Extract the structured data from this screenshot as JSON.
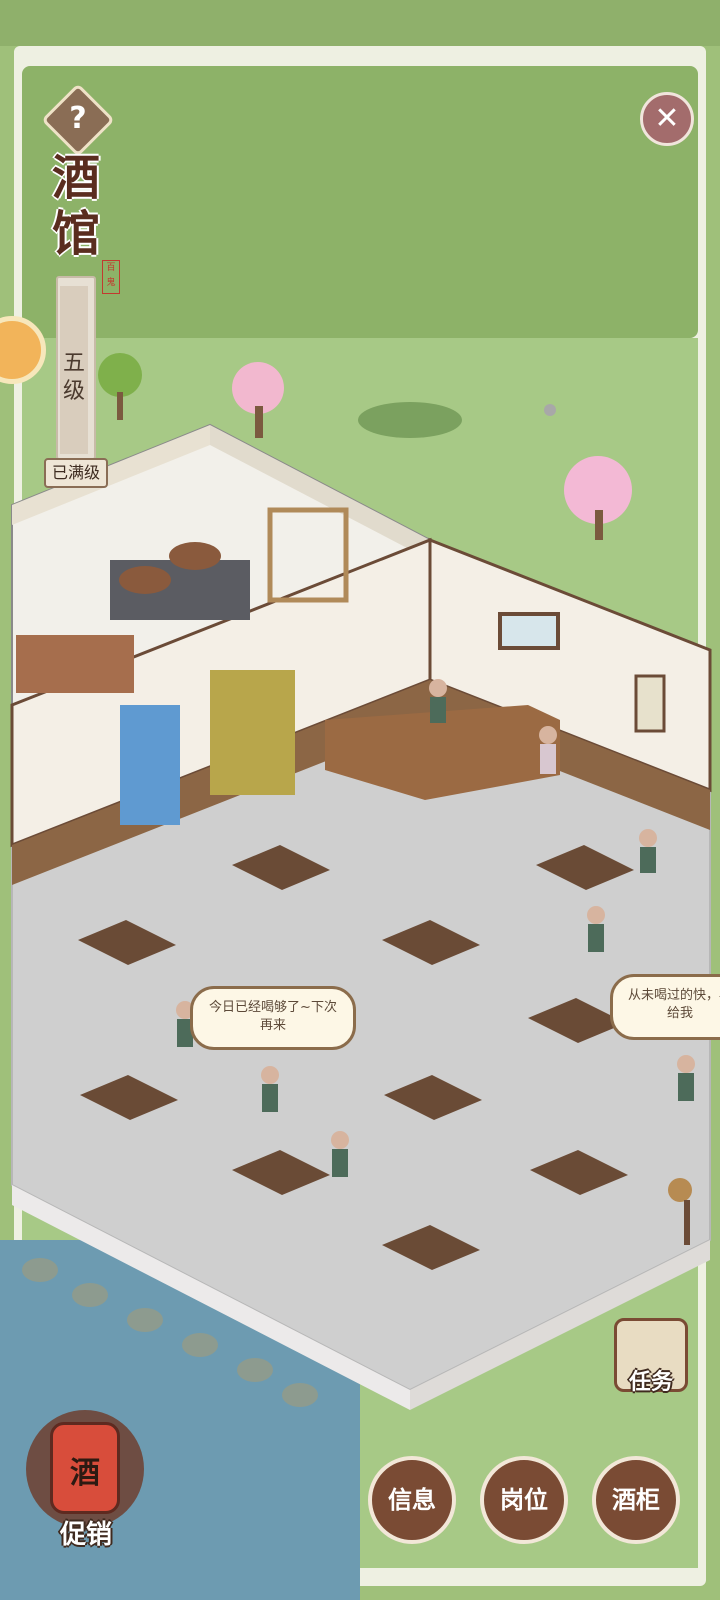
{
  "hud": {
    "help_label": "?",
    "title_line1": "酒",
    "title_line2": "馆",
    "seal_text": "百鬼",
    "level_text": "五级",
    "maxed_text": "已满级",
    "close_label": "✕"
  },
  "speech": {
    "left": "今日已经喝够了~下次再来",
    "right": "从未喝过的快，再给我"
  },
  "buttons": {
    "mission": "任务",
    "info": "信息",
    "position": "岗位",
    "cabinet": "酒柜",
    "promo_jar": "酒",
    "promo": "促销"
  },
  "colors": {
    "sky": "#8db268",
    "lawn": "#a7c986",
    "floor": "#cfcfcf",
    "wood": "#6b4b37",
    "accent": "#7a4b34"
  }
}
